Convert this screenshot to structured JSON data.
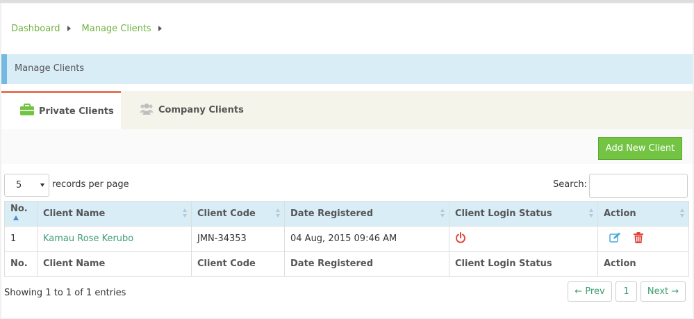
{
  "breadcrumb": {
    "items": [
      "Dashboard",
      "Manage Clients"
    ]
  },
  "section": {
    "title": "Manage Clients"
  },
  "tabs": [
    {
      "label": "Private Clients",
      "icon": "briefcase-icon",
      "active": true
    },
    {
      "label": "Company Clients",
      "icon": "users-icon",
      "active": false
    }
  ],
  "toolbar": {
    "add_label": "Add New Client"
  },
  "table_controls": {
    "page_length": "5",
    "page_length_label": "records per page",
    "search_label": "Search:",
    "search_value": ""
  },
  "table": {
    "columns": [
      "No.",
      "Client Name",
      "Client Code",
      "Date Registered",
      "Client Login Status",
      "Action"
    ],
    "rows": [
      {
        "no": "1",
        "name": "Kamau Rose Kerubo",
        "code": "JMN-34353",
        "date": "04 Aug, 2015 09:46 AM",
        "status_icon": "power-icon",
        "actions": [
          "edit-icon",
          "trash-icon"
        ]
      }
    ]
  },
  "footer": {
    "info": "Showing 1 to 1 of 1 entries",
    "prev": "← Prev",
    "page": "1",
    "next": "Next →"
  },
  "colors": {
    "accent_green": "#74c444",
    "link_green": "#3b9e70",
    "header_blue": "#d9edf7",
    "danger_red": "#e0483f",
    "edit_blue": "#4aa8dc",
    "tab_active_border": "#e8755a"
  }
}
